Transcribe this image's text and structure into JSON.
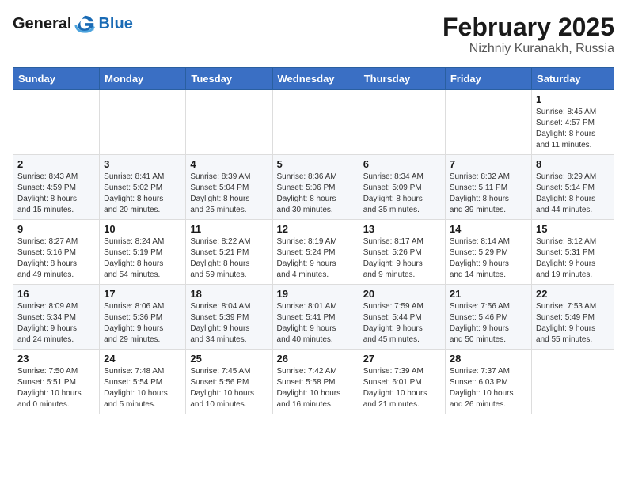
{
  "logo": {
    "line1": "General",
    "line2": "Blue"
  },
  "title": "February 2025",
  "subtitle": "Nizhniy Kuranakh, Russia",
  "weekdays": [
    "Sunday",
    "Monday",
    "Tuesday",
    "Wednesday",
    "Thursday",
    "Friday",
    "Saturday"
  ],
  "weeks": [
    [
      {
        "day": "",
        "info": ""
      },
      {
        "day": "",
        "info": ""
      },
      {
        "day": "",
        "info": ""
      },
      {
        "day": "",
        "info": ""
      },
      {
        "day": "",
        "info": ""
      },
      {
        "day": "",
        "info": ""
      },
      {
        "day": "1",
        "info": "Sunrise: 8:45 AM\nSunset: 4:57 PM\nDaylight: 8 hours\nand 11 minutes."
      }
    ],
    [
      {
        "day": "2",
        "info": "Sunrise: 8:43 AM\nSunset: 4:59 PM\nDaylight: 8 hours\nand 15 minutes."
      },
      {
        "day": "3",
        "info": "Sunrise: 8:41 AM\nSunset: 5:02 PM\nDaylight: 8 hours\nand 20 minutes."
      },
      {
        "day": "4",
        "info": "Sunrise: 8:39 AM\nSunset: 5:04 PM\nDaylight: 8 hours\nand 25 minutes."
      },
      {
        "day": "5",
        "info": "Sunrise: 8:36 AM\nSunset: 5:06 PM\nDaylight: 8 hours\nand 30 minutes."
      },
      {
        "day": "6",
        "info": "Sunrise: 8:34 AM\nSunset: 5:09 PM\nDaylight: 8 hours\nand 35 minutes."
      },
      {
        "day": "7",
        "info": "Sunrise: 8:32 AM\nSunset: 5:11 PM\nDaylight: 8 hours\nand 39 minutes."
      },
      {
        "day": "8",
        "info": "Sunrise: 8:29 AM\nSunset: 5:14 PM\nDaylight: 8 hours\nand 44 minutes."
      }
    ],
    [
      {
        "day": "9",
        "info": "Sunrise: 8:27 AM\nSunset: 5:16 PM\nDaylight: 8 hours\nand 49 minutes."
      },
      {
        "day": "10",
        "info": "Sunrise: 8:24 AM\nSunset: 5:19 PM\nDaylight: 8 hours\nand 54 minutes."
      },
      {
        "day": "11",
        "info": "Sunrise: 8:22 AM\nSunset: 5:21 PM\nDaylight: 8 hours\nand 59 minutes."
      },
      {
        "day": "12",
        "info": "Sunrise: 8:19 AM\nSunset: 5:24 PM\nDaylight: 9 hours\nand 4 minutes."
      },
      {
        "day": "13",
        "info": "Sunrise: 8:17 AM\nSunset: 5:26 PM\nDaylight: 9 hours\nand 9 minutes."
      },
      {
        "day": "14",
        "info": "Sunrise: 8:14 AM\nSunset: 5:29 PM\nDaylight: 9 hours\nand 14 minutes."
      },
      {
        "day": "15",
        "info": "Sunrise: 8:12 AM\nSunset: 5:31 PM\nDaylight: 9 hours\nand 19 minutes."
      }
    ],
    [
      {
        "day": "16",
        "info": "Sunrise: 8:09 AM\nSunset: 5:34 PM\nDaylight: 9 hours\nand 24 minutes."
      },
      {
        "day": "17",
        "info": "Sunrise: 8:06 AM\nSunset: 5:36 PM\nDaylight: 9 hours\nand 29 minutes."
      },
      {
        "day": "18",
        "info": "Sunrise: 8:04 AM\nSunset: 5:39 PM\nDaylight: 9 hours\nand 34 minutes."
      },
      {
        "day": "19",
        "info": "Sunrise: 8:01 AM\nSunset: 5:41 PM\nDaylight: 9 hours\nand 40 minutes."
      },
      {
        "day": "20",
        "info": "Sunrise: 7:59 AM\nSunset: 5:44 PM\nDaylight: 9 hours\nand 45 minutes."
      },
      {
        "day": "21",
        "info": "Sunrise: 7:56 AM\nSunset: 5:46 PM\nDaylight: 9 hours\nand 50 minutes."
      },
      {
        "day": "22",
        "info": "Sunrise: 7:53 AM\nSunset: 5:49 PM\nDaylight: 9 hours\nand 55 minutes."
      }
    ],
    [
      {
        "day": "23",
        "info": "Sunrise: 7:50 AM\nSunset: 5:51 PM\nDaylight: 10 hours\nand 0 minutes."
      },
      {
        "day": "24",
        "info": "Sunrise: 7:48 AM\nSunset: 5:54 PM\nDaylight: 10 hours\nand 5 minutes."
      },
      {
        "day": "25",
        "info": "Sunrise: 7:45 AM\nSunset: 5:56 PM\nDaylight: 10 hours\nand 10 minutes."
      },
      {
        "day": "26",
        "info": "Sunrise: 7:42 AM\nSunset: 5:58 PM\nDaylight: 10 hours\nand 16 minutes."
      },
      {
        "day": "27",
        "info": "Sunrise: 7:39 AM\nSunset: 6:01 PM\nDaylight: 10 hours\nand 21 minutes."
      },
      {
        "day": "28",
        "info": "Sunrise: 7:37 AM\nSunset: 6:03 PM\nDaylight: 10 hours\nand 26 minutes."
      },
      {
        "day": "",
        "info": ""
      }
    ]
  ]
}
